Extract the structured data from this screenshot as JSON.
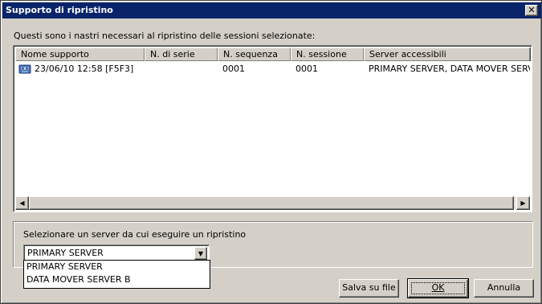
{
  "window": {
    "title": "Supporto di ripristino",
    "close_glyph": "✕"
  },
  "instruction": "Questi sono i nastri necessari al ripristino delle sessioni selezionate:",
  "list": {
    "columns": [
      "Nome supporto",
      "N. di serie",
      "N. sequenza",
      "N. sessione",
      "Server accessibili"
    ],
    "rows": [
      {
        "icon": "tape-media-icon",
        "nome_supporto": "23/06/10 12:58 [F5F3]",
        "n_serie": "",
        "n_sequenza": "0001",
        "n_sessione": "0001",
        "server_accessibili": "PRIMARY SERVER, DATA MOVER SERV"
      }
    ]
  },
  "server_group": {
    "label": "Selezionare un server da cui eseguire un ripristino",
    "selected": "PRIMARY SERVER",
    "options": [
      "PRIMARY SERVER",
      "DATA MOVER SERVER B"
    ]
  },
  "buttons": {
    "save": "Salva su file",
    "ok": "OK",
    "cancel": "Annulla"
  },
  "icons": {
    "scroll_left": "◀",
    "scroll_right": "▶",
    "combo_arrow": "▼"
  }
}
